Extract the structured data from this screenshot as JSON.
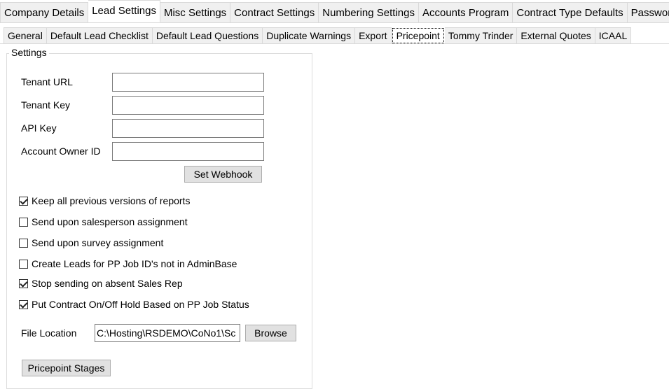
{
  "main_tabs": [
    {
      "label": "Company Details",
      "active": false
    },
    {
      "label": "Lead Settings",
      "active": true
    },
    {
      "label": "Misc Settings",
      "active": false
    },
    {
      "label": "Contract Settings",
      "active": false
    },
    {
      "label": "Numbering Settings",
      "active": false
    },
    {
      "label": "Accounts Program",
      "active": false
    },
    {
      "label": "Contract Type Defaults",
      "active": false
    },
    {
      "label": "Passwords",
      "active": false
    }
  ],
  "sub_tabs": [
    {
      "label": "General",
      "active": false
    },
    {
      "label": "Default Lead Checklist",
      "active": false
    },
    {
      "label": "Default Lead Questions",
      "active": false
    },
    {
      "label": "Duplicate Warnings",
      "active": false
    },
    {
      "label": "Export",
      "active": false
    },
    {
      "label": "Pricepoint",
      "active": true
    },
    {
      "label": "Tommy Trinder",
      "active": false
    },
    {
      "label": "External Quotes",
      "active": false
    },
    {
      "label": "ICAAL",
      "active": false
    }
  ],
  "settings": {
    "group_title": "Settings",
    "tenant_url_label": "Tenant URL",
    "tenant_url_value": "",
    "tenant_key_label": "Tenant Key",
    "tenant_key_value": "",
    "api_key_label": "API Key",
    "api_key_value": "",
    "account_owner_label": "Account Owner ID",
    "account_owner_value": "",
    "set_webhook_label": "Set Webhook",
    "checkboxes": [
      {
        "label": "Keep all previous versions of reports",
        "checked": true
      },
      {
        "label": "Send upon salesperson assignment",
        "checked": false
      },
      {
        "label": "Send upon survey assignment",
        "checked": false
      },
      {
        "label": "Create Leads for PP Job ID's not in AdminBase",
        "checked": false
      },
      {
        "label": "Stop sending on absent Sales Rep",
        "checked": true
      },
      {
        "label": "Put Contract On/Off Hold Based on PP Job Status",
        "checked": true
      }
    ],
    "file_location_label": "File Location",
    "file_location_value": "C:\\Hosting\\RSDEMO\\CoNo1\\Sc",
    "browse_label": "Browse",
    "pricepoint_stages_label": "Pricepoint Stages"
  }
}
